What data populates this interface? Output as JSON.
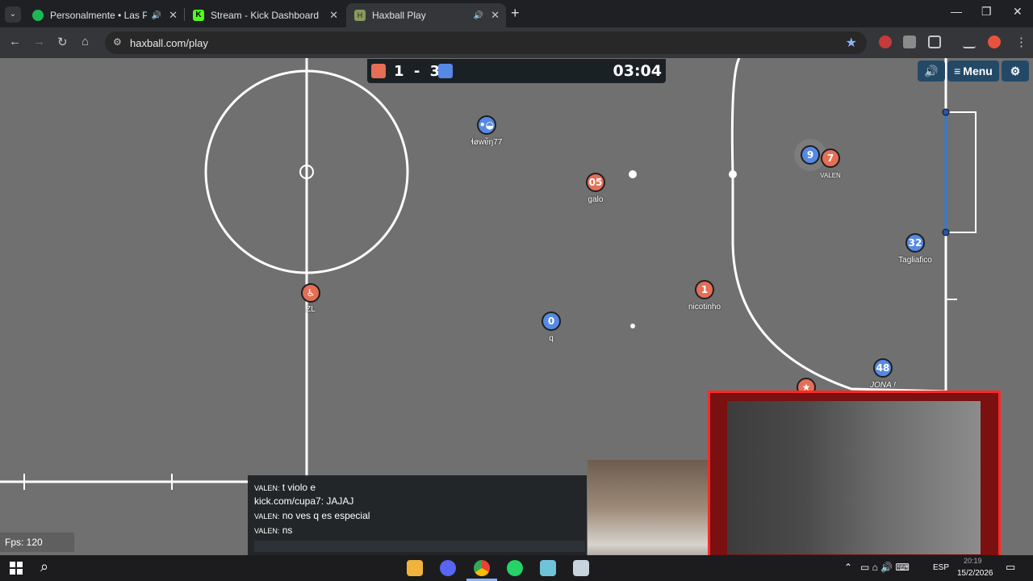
{
  "browser": {
    "tabs": [
      {
        "title": "Personalmente • Las Pelotas",
        "favicon": "spotify-icon",
        "color": "#1db954"
      },
      {
        "title": "Stream - Kick Dashboard",
        "favicon": "kick-icon",
        "color": "#53fc18"
      },
      {
        "title": "Haxball Play",
        "favicon": "haxball-icon",
        "color": "#8a9a5b"
      }
    ],
    "url": "haxball.com/play"
  },
  "game": {
    "red_score": "1",
    "score_sep": "-",
    "blue_score": "3",
    "timer": "03:04",
    "menu_label": "Menu",
    "fps_label": "Fps: 120",
    "colors": {
      "red": "#e56e56",
      "blue": "#5689e5",
      "field": "#707070"
    },
    "players": [
      {
        "team": "blue",
        "avatar": "•◒",
        "name": "ɬøwɐ̃ŋ77"
      },
      {
        "team": "red",
        "avatar": "05",
        "name": "galo"
      },
      {
        "team": "blue",
        "avatar": "9",
        "name": ""
      },
      {
        "team": "red",
        "avatar": "7",
        "name": "VALEN"
      },
      {
        "team": "blue",
        "avatar": "32",
        "name": "Tagliafico"
      },
      {
        "team": "red",
        "avatar": "1",
        "name": "nicotinho"
      },
      {
        "team": "red",
        "avatar": "♿",
        "name": "ZL"
      },
      {
        "team": "blue",
        "avatar": "0",
        "name": "q"
      },
      {
        "team": "blue",
        "avatar": "48",
        "name": "JONA !"
      },
      {
        "team": "red",
        "avatar": "★",
        "name": ""
      }
    ]
  },
  "chat": [
    {
      "nick": "VALEN:",
      "text": " t violo e"
    },
    {
      "nick": "",
      "text": "kick.com/cupa7: JAJAJ"
    },
    {
      "nick": "VALEN:",
      "text": " no ves q es especial"
    },
    {
      "nick": "VALEN:",
      "text": " ns"
    }
  ],
  "taskbar": {
    "lang": "ESP",
    "date": "15/2/2026",
    "time": "20:19"
  }
}
